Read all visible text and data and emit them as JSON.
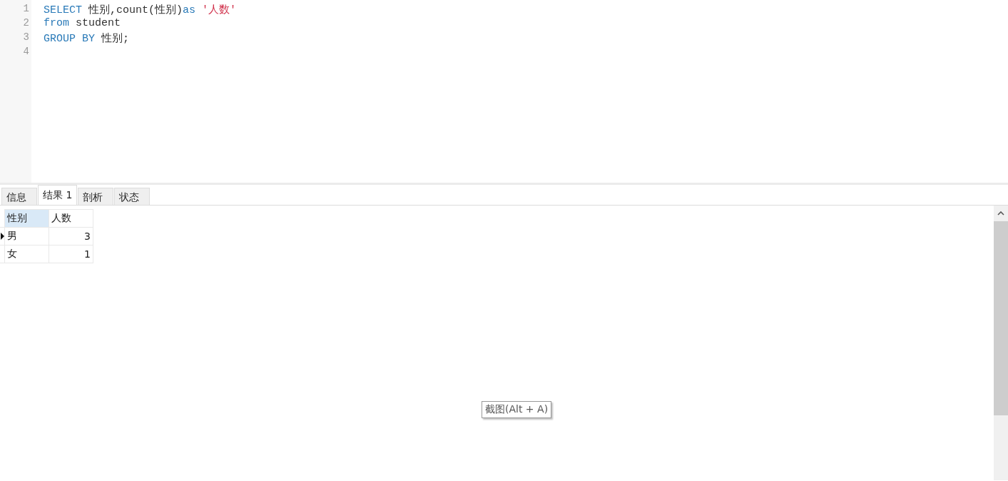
{
  "editor": {
    "lines": [
      {
        "number": "1",
        "tokens": [
          {
            "kind": "keyword",
            "text": "SELECT"
          },
          {
            "kind": "plain",
            "text": " 性别,count(性别)"
          },
          {
            "kind": "keyword",
            "text": "as"
          },
          {
            "kind": "string",
            "text": " '人数'"
          }
        ]
      },
      {
        "number": "2",
        "tokens": [
          {
            "kind": "keyword",
            "text": "from"
          },
          {
            "kind": "plain",
            "text": " student"
          }
        ]
      },
      {
        "number": "3",
        "tokens": [
          {
            "kind": "keyword",
            "text": "GROUP BY"
          },
          {
            "kind": "plain",
            "text": " 性别;"
          }
        ]
      },
      {
        "number": "4"
      }
    ]
  },
  "tabs": [
    {
      "label": "信息",
      "selected": false
    },
    {
      "label": "结果 1",
      "selected": true
    },
    {
      "label": "剖析",
      "selected": false
    },
    {
      "label": "状态",
      "selected": false
    }
  ],
  "grid": {
    "columns": [
      {
        "label": "性别",
        "selected": true
      },
      {
        "label": "人数",
        "selected": false
      }
    ],
    "rows": [
      {
        "current": true,
        "cells": [
          "男",
          "3"
        ]
      },
      {
        "current": false,
        "cells": [
          "女",
          "1"
        ]
      }
    ]
  },
  "tooltip": {
    "text": "截图(Alt + A)"
  }
}
